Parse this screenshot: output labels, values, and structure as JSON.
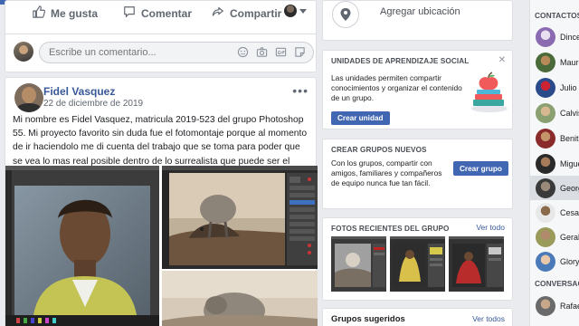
{
  "post_actions": {
    "like": "Me gusta",
    "comment": "Comentar",
    "share": "Compartir"
  },
  "comment_input": {
    "placeholder": "Escribe un comentario..."
  },
  "post": {
    "author": "Fidel Vasquez",
    "date": "22 de diciembre de 2019",
    "menu": "•••",
    "body": "Mi nombre es Fidel Vasquez, matricula 2019-523 del grupo Photoshop 55. Mi proyecto favorito sin duda fue el fotomontaje porque al momento de ir haciendolo me di cuenta del trabajo que se toma para poder que se vea lo mas real posible dentro de lo surrealista que puede ser el tema."
  },
  "location": {
    "label": "Agregar ubicación"
  },
  "units": {
    "title": "UNIDADES DE APRENDIZAJE SOCIAL",
    "close": "✕",
    "text": "Las unidades permiten compartir conocimientos y organizar el contenido de un grupo.",
    "button": "Crear unidad"
  },
  "create_groups": {
    "title": "CREAR GRUPOS NUEVOS",
    "text": "Con los grupos, compartir con amigos, familiares y compañeros de equipo nunca fue tan fácil.",
    "button": "Crear grupo"
  },
  "recent_photos": {
    "title": "FOTOS RECIENTES DEL GRUPO",
    "view_all": "Ver todo"
  },
  "suggested_groups": {
    "title": "Grupos sugeridos",
    "view_all": "Ver todos"
  },
  "contacts": {
    "header": "CONTACTOS",
    "items": [
      {
        "name": "Dincel"
      },
      {
        "name": "Mauro"
      },
      {
        "name": "Julio F"
      },
      {
        "name": "Calvis"
      },
      {
        "name": "Benito"
      },
      {
        "name": "Miguel"
      },
      {
        "name": "Georg"
      },
      {
        "name": "Cesar"
      },
      {
        "name": "Gerald"
      },
      {
        "name": "Glory"
      }
    ],
    "conversations_header": "CONVERSAC",
    "conversations": [
      {
        "name": "Rafae"
      }
    ]
  },
  "colors": {
    "brand": "#4267b2",
    "link": "#385898",
    "background": "#e9ebee"
  }
}
